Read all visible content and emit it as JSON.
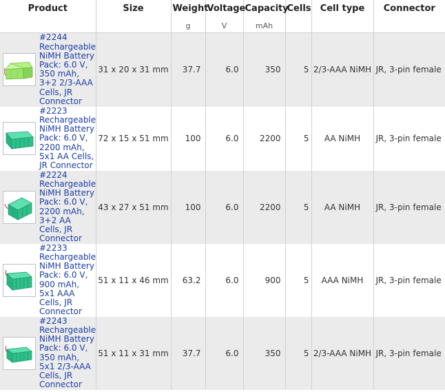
{
  "headers": {
    "product": "Product",
    "size": "Size",
    "weight": "Weight",
    "voltage": "Voltage",
    "capacity": "Capacity",
    "cells": "Cells",
    "cell_type": "Cell type",
    "connector": "Connector"
  },
  "units": {
    "weight": "g",
    "voltage": "V",
    "capacity": "mAh"
  },
  "rows": [
    {
      "product": "#2244 Rechargeable NiMH Battery Pack: 6.0 V, 350 mAh, 3+2 2/3-AAA Cells, JR Connector",
      "size": "31 x 20 x 31 mm",
      "weight": "37.7",
      "voltage": "6.0",
      "capacity": "350",
      "cells": "5",
      "cell_type": "2/3-AAA NiMH",
      "connector": "JR, 3-pin female",
      "image_icon": "battery-pack-light-green-icon"
    },
    {
      "product": "#2223 Rechargeable NiMH Battery Pack: 6.0 V, 2200 mAh, 5x1 AA Cells, JR Connector",
      "size": "72 x 15 x 51 mm",
      "weight": "100",
      "voltage": "6.0",
      "capacity": "2200",
      "cells": "5",
      "cell_type": "AA NiMH",
      "connector": "JR, 3-pin female",
      "image_icon": "battery-pack-teal-icon"
    },
    {
      "product": "#2224 Rechargeable NiMH Battery Pack: 6.0 V, 2200 mAh, 3+2 AA Cells, JR Connector",
      "size": "43 x 27 x 51 mm",
      "weight": "100",
      "voltage": "6.0",
      "capacity": "2200",
      "cells": "5",
      "cell_type": "AA NiMH",
      "connector": "JR, 3-pin female",
      "image_icon": "battery-pack-teal-icon"
    },
    {
      "product": "#2233 Rechargeable NiMH Battery Pack: 6.0 V, 900 mAh, 5x1 AAA Cells, JR Connector",
      "size": "51 x 11 x 46 mm",
      "weight": "63.2",
      "voltage": "6.0",
      "capacity": "900",
      "cells": "5",
      "cell_type": "AAA NiMH",
      "connector": "JR, 3-pin female",
      "image_icon": "battery-pack-teal-icon"
    },
    {
      "product": "#2243 Rechargeable NiMH Battery Pack: 6.0 V, 350 mAh, 5x1 2/3-AAA Cells, JR Connector",
      "size": "51 x 11 x 31 mm",
      "weight": "37.7",
      "voltage": "6.0",
      "capacity": "350",
      "cells": "5",
      "cell_type": "2/3-AAA NiMH",
      "connector": "JR, 3-pin female",
      "image_icon": "battery-pack-teal-icon"
    }
  ],
  "colors": {
    "link": "#1a3ea8",
    "row_alt": "#ebebeb",
    "pack_light_green": "#9be36a",
    "pack_teal": "#2fbf8a"
  }
}
